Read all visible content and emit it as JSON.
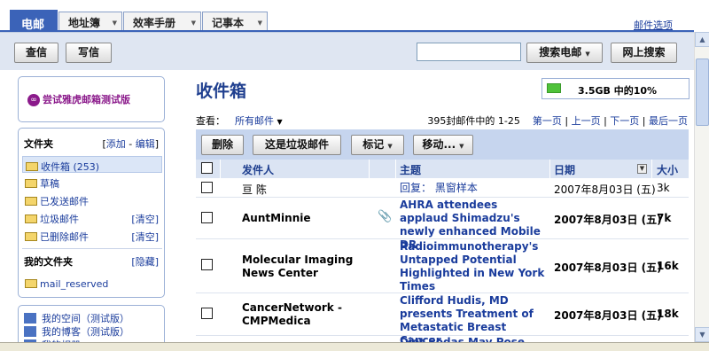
{
  "tabs": [
    {
      "label": "电邮"
    },
    {
      "label": "地址簿"
    },
    {
      "label": "效率手册"
    },
    {
      "label": "记事本"
    }
  ],
  "mail_options": "邮件选项",
  "toolbar": {
    "check_mail": "查信",
    "compose": "写信",
    "search_mail": "搜索电邮",
    "web_search": "网上搜索"
  },
  "sidebar": {
    "trial_link": "尝试雅虎邮箱测试版",
    "folders_title": "文件夹",
    "folders_add": "添加",
    "folders_edit": "编辑",
    "folders": [
      {
        "label": "收件箱 (253)"
      },
      {
        "label": "草稿"
      },
      {
        "label": "已发送邮件"
      },
      {
        "label": "垃圾邮件",
        "action": "[清空]"
      },
      {
        "label": "已删除邮件",
        "action": "[清空]"
      }
    ],
    "my_folders_title": "我的文件夹",
    "my_folders_hide": "[隐藏]",
    "my_folders": [
      {
        "label": "mail_reserved"
      }
    ],
    "space_links": [
      {
        "label": "我的空间（测试版）"
      },
      {
        "label": "我的博客（测试版）"
      },
      {
        "label": "我的相册"
      }
    ]
  },
  "main": {
    "title": "收件箱",
    "quota_text": "3.5GB 中的10%",
    "quota_percent": 10,
    "view_label": "查看：",
    "view_value": "所有邮件",
    "pager": {
      "summary": "395封邮件中的 1-25",
      "first": "第一页",
      "prev": "上一页",
      "next": "下一页",
      "last": "最后一页"
    },
    "actions": {
      "delete": "删除",
      "spam": "这是垃圾邮件",
      "mark": "标记",
      "move": "移动..."
    },
    "columns": {
      "from": "发件人",
      "subject": "主题",
      "date": "日期",
      "size": "大小"
    },
    "rows": [
      {
        "from": "亘 陈",
        "subject": "回复： 黑窗样本",
        "date": "2007年8月03日 (五)",
        "size": "3k",
        "attachment": false
      },
      {
        "from": "AuntMinnie",
        "subject": "AHRA attendees applaud Shimadzu's newly enhanced Mobile DR",
        "date": "2007年8月03日 (五)",
        "size": "7k",
        "attachment": true
      },
      {
        "from": "Molecular Imaging News Center",
        "subject": "Radioimmunotherapy's Untapped Potential Highlighted in New York Times",
        "date": "2007年8月03日 (五)",
        "size": "16k",
        "attachment": false
      },
      {
        "from": "CancerNetwork - CMPMedica",
        "subject": "Clifford Hudis, MD presents Treatment of Metastatic Breast Cancer",
        "date": "2007年8月03日 (五)",
        "size": "18k",
        "attachment": false
      },
      {
        "from": "",
        "subject": "Diet Sodas May Pose Health",
        "date": "",
        "size": "",
        "attachment": false
      }
    ]
  }
}
